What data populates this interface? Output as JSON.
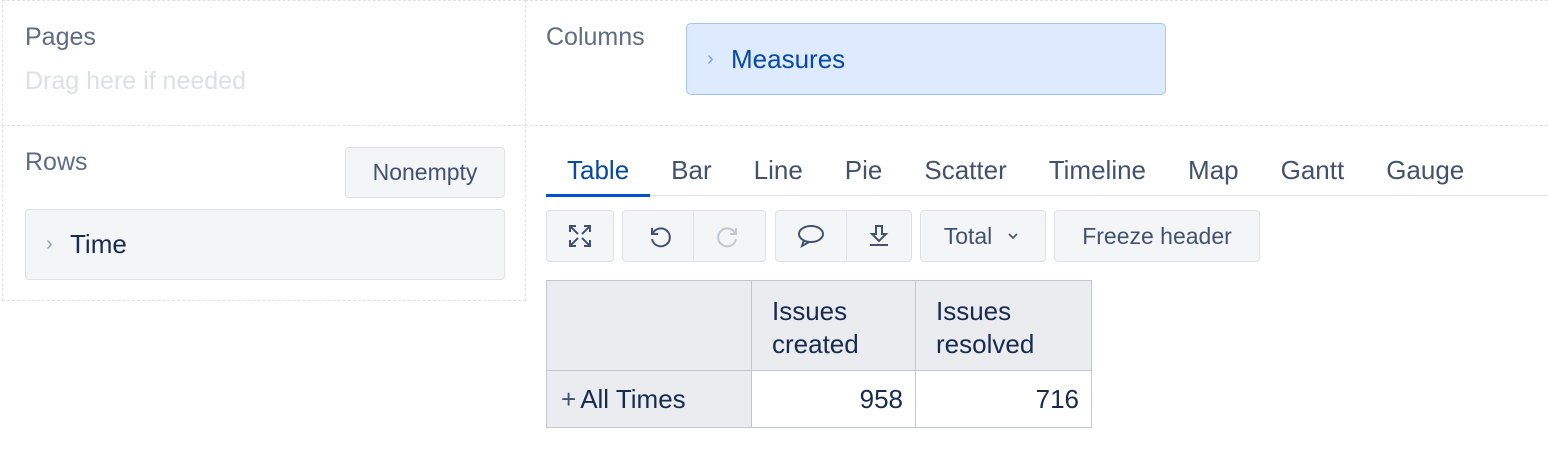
{
  "pages": {
    "label": "Pages",
    "hint": "Drag here if needed"
  },
  "rows": {
    "label": "Rows",
    "nonempty_label": "Nonempty",
    "dimension": "Time"
  },
  "columns": {
    "label": "Columns",
    "dimension": "Measures"
  },
  "tabs": [
    {
      "label": "Table",
      "active": true
    },
    {
      "label": "Bar"
    },
    {
      "label": "Line"
    },
    {
      "label": "Pie"
    },
    {
      "label": "Scatter"
    },
    {
      "label": "Timeline"
    },
    {
      "label": "Map"
    },
    {
      "label": "Gantt"
    },
    {
      "label": "Gauge"
    }
  ],
  "toolbar": {
    "total_label": "Total",
    "freeze_label": "Freeze header",
    "icons": [
      "fullscreen-icon",
      "undo-icon",
      "redo-icon",
      "comment-icon",
      "download-icon",
      "chevron-down-icon"
    ]
  },
  "table": {
    "headers": [
      "",
      "Issues created",
      "Issues resolved"
    ],
    "rows": [
      {
        "label": "All Times",
        "expand": "+",
        "values": [
          "958",
          "716"
        ]
      }
    ]
  },
  "colors": {
    "accent": "#0052cc",
    "chip_bg": "#deebff",
    "chip_text": "#0747a6",
    "muted": "#5e6c84"
  }
}
